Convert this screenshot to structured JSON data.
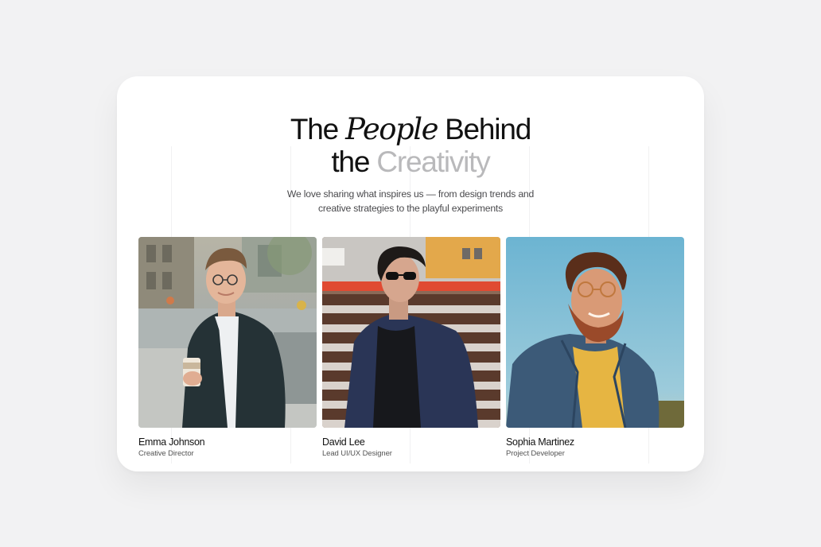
{
  "heading": {
    "line1_start": "The ",
    "line1_serif": "People",
    "line1_end": " Behind",
    "line2_start": "the ",
    "line2_muted": "Creativity"
  },
  "subtitle": {
    "line1": "We love sharing what inspires us — from design trends and",
    "line2": "creative strategies to the playful experiments"
  },
  "members": [
    {
      "name": "Emma Johnson",
      "role": "Creative Director",
      "photo": "portrait-man-coffee-city"
    },
    {
      "name": "David Lee",
      "role": "Lead UI/UX Designer",
      "photo": "portrait-man-sunglasses"
    },
    {
      "name": "Sophia Martinez",
      "role": "Project Developer",
      "photo": "portrait-man-denim-sky"
    }
  ],
  "colors": {
    "background": "#f2f2f3",
    "card": "#ffffff",
    "muted_heading": "#b9b9bb",
    "text": "#111111"
  }
}
